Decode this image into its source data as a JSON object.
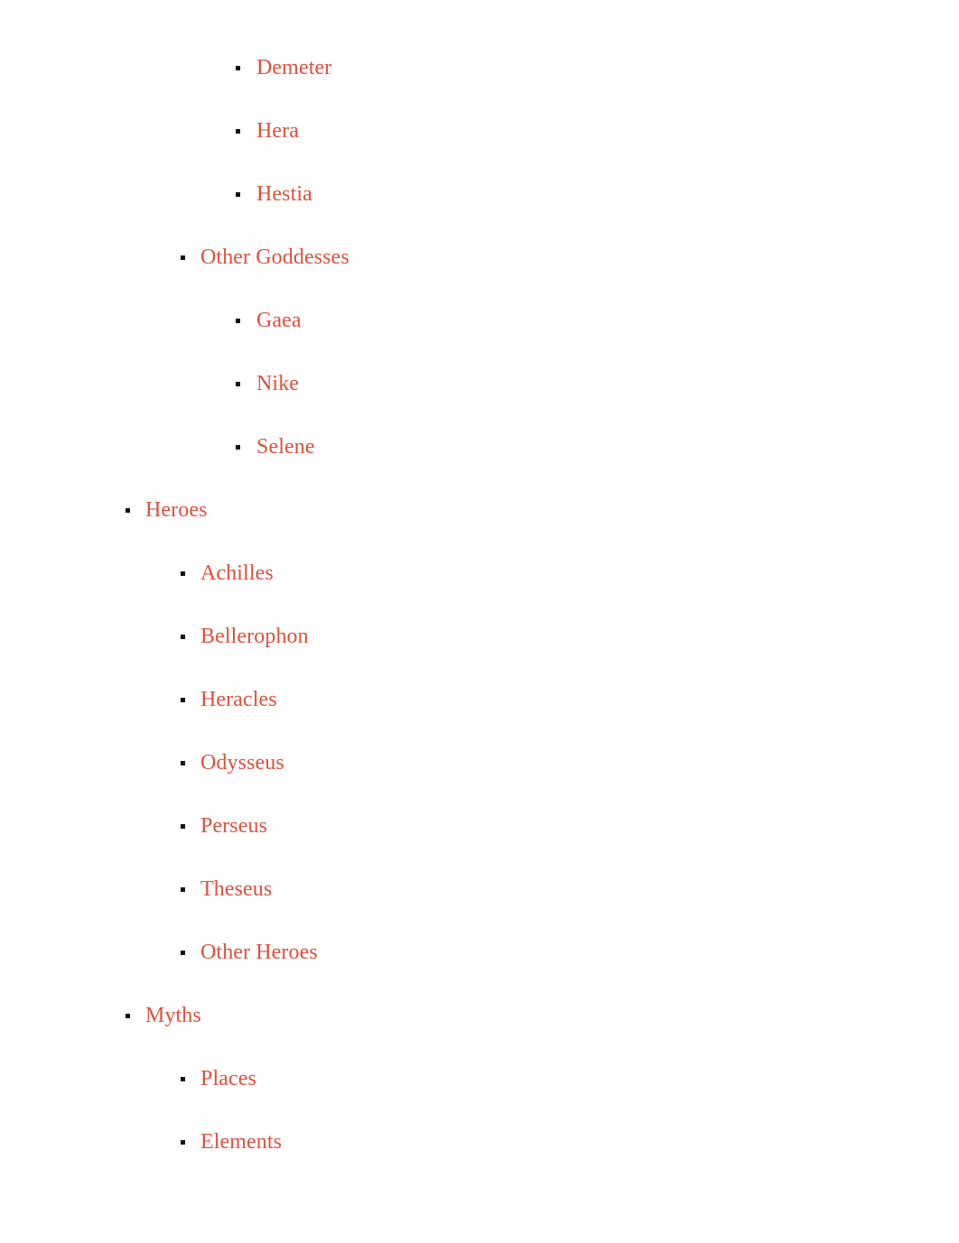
{
  "document": {
    "type": "nested-bulleted-outline",
    "background_color": "#ffffff",
    "text_color": "#DE503C",
    "bullet_color": "#141414",
    "bullet_glyph": "•"
  },
  "outline": {
    "items": [
      {
        "label": "Demeter",
        "level": 3
      },
      {
        "label": "Hera",
        "level": 3
      },
      {
        "label": "Hestia",
        "level": 3
      },
      {
        "label": "Other Goddesses",
        "level": 2
      },
      {
        "label": "Gaea",
        "level": 3
      },
      {
        "label": "Nike",
        "level": 3
      },
      {
        "label": "Selene",
        "level": 3
      },
      {
        "label": "Heroes",
        "level": 1
      },
      {
        "label": "Achilles",
        "level": 2
      },
      {
        "label": "Bellerophon",
        "level": 2
      },
      {
        "label": "Heracles",
        "level": 2
      },
      {
        "label": "Odysseus",
        "level": 2
      },
      {
        "label": "Perseus",
        "level": 2
      },
      {
        "label": "Theseus",
        "level": 2
      },
      {
        "label": "Other Heroes",
        "level": 2
      },
      {
        "label": "Myths",
        "level": 1
      },
      {
        "label": "Places",
        "level": 2
      },
      {
        "label": "Elements",
        "level": 2
      }
    ]
  }
}
